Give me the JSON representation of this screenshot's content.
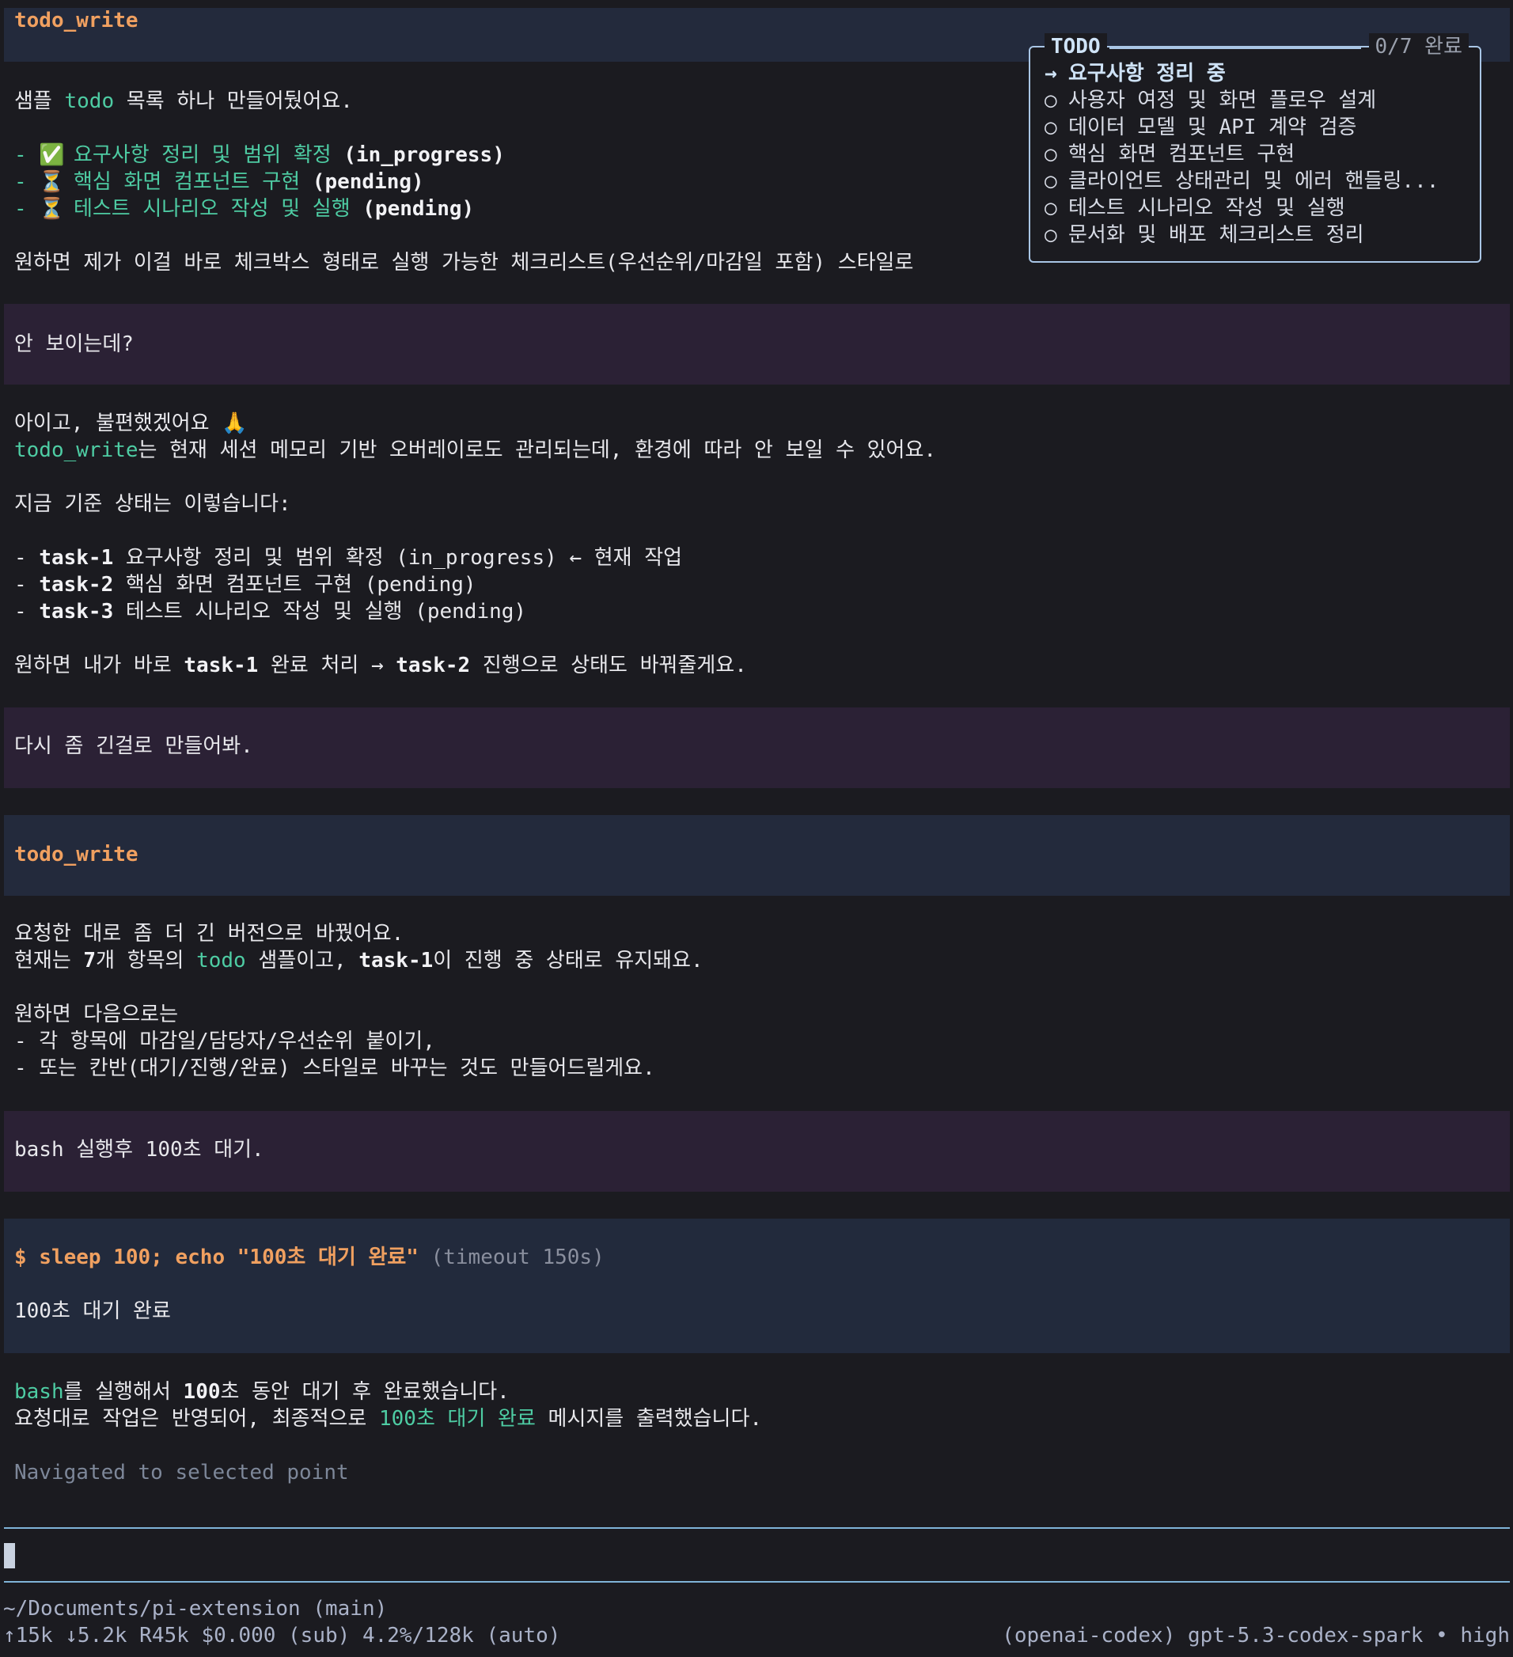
{
  "top_dots": "···",
  "block1": {
    "tool_name": "todo_write",
    "intro_pre": "샘플 ",
    "intro_todo": "todo",
    "intro_post": " 목록 하나 만들어뒀어요.",
    "items": [
      {
        "prefix": "- ",
        "emoji": "✅",
        "text": "요구사항 정리 및 범위 확정",
        "status": " (in_progress)"
      },
      {
        "prefix": "- ",
        "emoji": "⏳",
        "text": "핵심 화면 컴포넌트 구현",
        "status": " (pending)"
      },
      {
        "prefix": "- ",
        "emoji": "⏳",
        "text": "테스트 시나리오 작성 및 실행",
        "status": " (pending)"
      }
    ],
    "offer": "원하면 제가 이걸 바로 체크박스 형태로 실행 가능한 체크리스트(우선순위/마감일 포함) 스타일로"
  },
  "user1": "안 보이는데?",
  "reply1": {
    "line1_text": "아이고, 불편했겠어요 ",
    "line1_emoji": "🙏",
    "line2_tool": "todo_write",
    "line2_rest": "는 현재 세션 메모리 기반 오버레이로도 관리되는데, 환경에 따라 안 보일 수 있어요.",
    "line3": "지금 기준 상태는 이렇습니다:",
    "tasks": [
      {
        "prefix": "- ",
        "id": "task-1",
        "text": " 요구사항 정리 및 범위 확정 (in_progress) ← 현재 작업"
      },
      {
        "prefix": "- ",
        "id": "task-2",
        "text": " 핵심 화면 컴포넌트 구현 (pending)"
      },
      {
        "prefix": "- ",
        "id": "task-3",
        "text": " 테스트 시나리오 작성 및 실행 (pending)"
      }
    ],
    "offer_a": "원하면 내가 바로 ",
    "offer_b": "task-1",
    "offer_c": " 완료 처리 → ",
    "offer_d": "task-2",
    "offer_e": " 진행으로 상태도 바꿔줄게요."
  },
  "user2": "다시 좀 긴걸로 만들어봐.",
  "block2": {
    "tool_name": "todo_write",
    "line1": "요청한 대로 좀 더 긴 버전으로 바꿨어요.",
    "line2_a": "현재는 ",
    "line2_b": "7",
    "line2_c": "개 항목의 ",
    "line2_d": "todo",
    "line2_e": " 샘플이고, ",
    "line2_f": "task-1",
    "line2_g": "이 진행 중 상태로 유지돼요.",
    "line3": "원하면 다음으로는",
    "line4": "- 각 항목에 마감일/담당자/우선순위 붙이기,",
    "line5": "- 또는 칸반(대기/진행/완료) 스타일로 바꾸는 것도 만들어드릴게요."
  },
  "user3": "bash 실행후 100초 대기.",
  "bash": {
    "command": "$ sleep 100; echo \"100초 대기 완료\"",
    "timeout": " (timeout 150s)",
    "output": "100초 대기 완료"
  },
  "reply2": {
    "l1_a": "bash",
    "l1_b": "를 실행해서 ",
    "l1_c": "100",
    "l1_d": "초 동안 대기 후 완료했습니다.",
    "l2_a": "요청대로 작업은 반영되어, 최종적으로 ",
    "l2_b": "100초 대기 완료",
    "l2_c": " 메시지를 출력했습니다."
  },
  "nav_status": "Navigated to selected point",
  "todo_overlay": {
    "title": "TODO",
    "count": "0/7 완료",
    "items": [
      {
        "mark": "→",
        "text": "요구사항 정리 중",
        "active": true
      },
      {
        "mark": "○",
        "text": "사용자 여정 및 화면 플로우 설계",
        "active": false
      },
      {
        "mark": "○",
        "text": "데이터 모델 및 API 계약 검증",
        "active": false
      },
      {
        "mark": "○",
        "text": "핵심 화면 컴포넌트 구현",
        "active": false
      },
      {
        "mark": "○",
        "text": "클라이언트 상태관리 및 에러 핸들링...",
        "active": false
      },
      {
        "mark": "○",
        "text": "테스트 시나리오 작성 및 실행",
        "active": false
      },
      {
        "mark": "○",
        "text": "문서화 및 배포 체크리스트 정리",
        "active": false
      }
    ]
  },
  "footer": {
    "path": "~/Documents/pi-extension (main)",
    "stats": "↑15k ↓5.2k R45k $0.000 (sub) 4.2%/128k (auto)",
    "model": "(openai-codex) gpt-5.3-codex-spark • high"
  },
  "colors": {
    "background": "#1b1b20",
    "tool_band": "#232a3c",
    "user_band": "#2b2135",
    "accent_green": "#4ecca3",
    "accent_orange": "#f0a060",
    "overlay_border": "#a9c6e6"
  }
}
